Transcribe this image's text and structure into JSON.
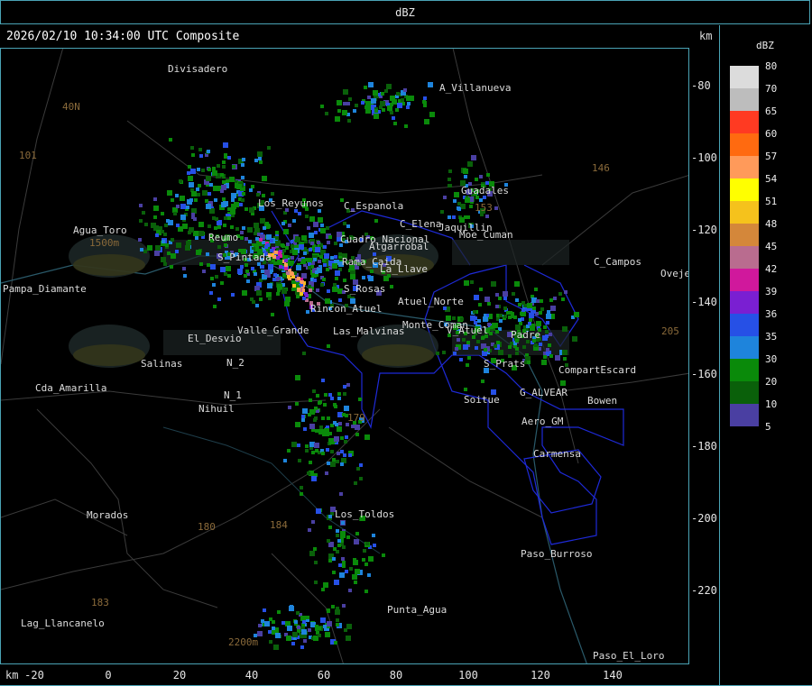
{
  "window": {
    "title": "dBZ"
  },
  "header": {
    "timestamp": "2026/02/10 10:34:00 UTC Composite",
    "unit_right": "km",
    "unit_bottom": "km"
  },
  "axes": {
    "y_ticks": [
      "-80",
      "-100",
      "-120",
      "-140",
      "-160",
      "-180",
      "-200",
      "-220"
    ],
    "x_ticks": [
      "-20",
      "0",
      "20",
      "40",
      "60",
      "80",
      "100",
      "120",
      "140"
    ]
  },
  "legend": {
    "title": "dBZ",
    "entries": [
      {
        "label": "80",
        "color": "#dcdcdc"
      },
      {
        "label": "70",
        "color": "#bdbdbd"
      },
      {
        "label": "65",
        "color": "#ff3a22"
      },
      {
        "label": "60",
        "color": "#ff6a10"
      },
      {
        "label": "57",
        "color": "#ff9a5a"
      },
      {
        "label": "54",
        "color": "#ffff00"
      },
      {
        "label": "51",
        "color": "#f5c21c"
      },
      {
        "label": "48",
        "color": "#d4873a"
      },
      {
        "label": "45",
        "color": "#b96c8f"
      },
      {
        "label": "42",
        "color": "#d0189c"
      },
      {
        "label": "39",
        "color": "#7a1fd2"
      },
      {
        "label": "36",
        "color": "#2650e6"
      },
      {
        "label": "35",
        "color": "#1e84dc"
      },
      {
        "label": "30",
        "color": "#0a8a0a"
      },
      {
        "label": "20",
        "color": "#0a600a"
      },
      {
        "label": "10",
        "color": "#4a3fa2"
      }
    ],
    "last_label": "5"
  },
  "places": [
    "Divisadero",
    "A_Villanueva",
    "Guadales",
    "40N",
    "101",
    "Agua_Toro",
    "1500m",
    "Pampa_Diamante",
    "El_Desvio",
    "Salinas",
    "Cda_Amarilla",
    "Nihuil",
    "N_1",
    "N_2",
    "Valle_Grande",
    "Las_Malvinas",
    "V_Atuel",
    "Padre",
    "S_Prats",
    "CompartEscard",
    "G_ALVEAR",
    "Bowen",
    "Soitue",
    "Aero_GM",
    "Carmensa",
    "Los_Toldos",
    "Morados",
    "Paso_Burroso",
    "Punta_Agua",
    "Lag_Llancanelo",
    "Paso_El_Loro",
    "C_Campos",
    "Ovejero",
    "Atuel_Norte",
    "S_Rosas",
    "Cuadro_Nacional",
    "La_Llave",
    "C_Espanola",
    "C_Elena",
    "Jaquillin",
    "Moe_Cuman",
    "Algarrobal",
    "Rama_Caida",
    "Monte_Coman",
    "Reumo",
    "S_Pintada",
    "Los_Reyunos",
    "Rincon_Atuel",
    "184",
    "180",
    "179",
    "183",
    "146",
    "153",
    "205",
    "2200m"
  ]
}
